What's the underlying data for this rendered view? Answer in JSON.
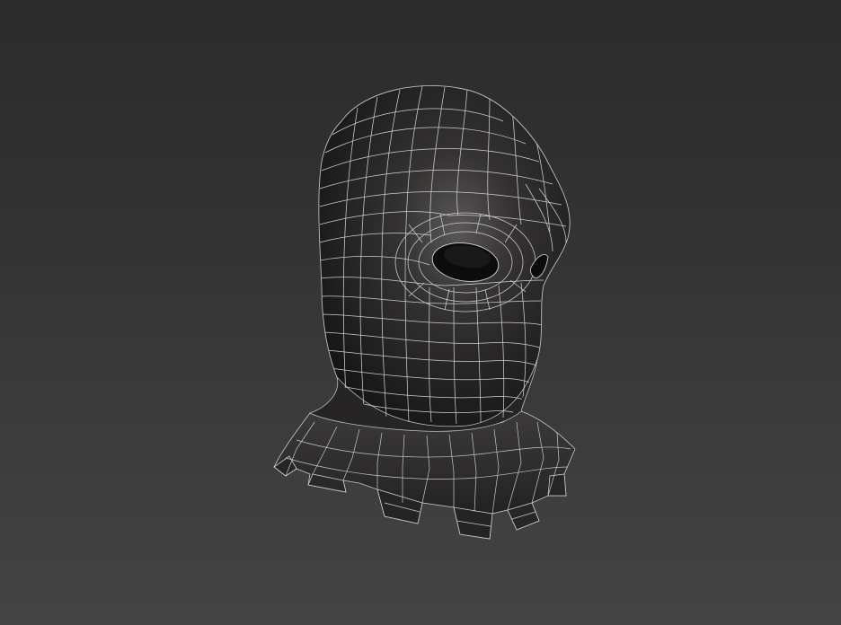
{
  "viewport": {
    "name": "3D viewport",
    "background_top": "#2b2b2b",
    "background_bottom": "#444444"
  },
  "model": {
    "object": "balaclava-mask-mesh",
    "display_mode": "shaded-with-wireframe",
    "surface_color": "#1f1d1d",
    "wire_color": "#cfcfcf"
  }
}
